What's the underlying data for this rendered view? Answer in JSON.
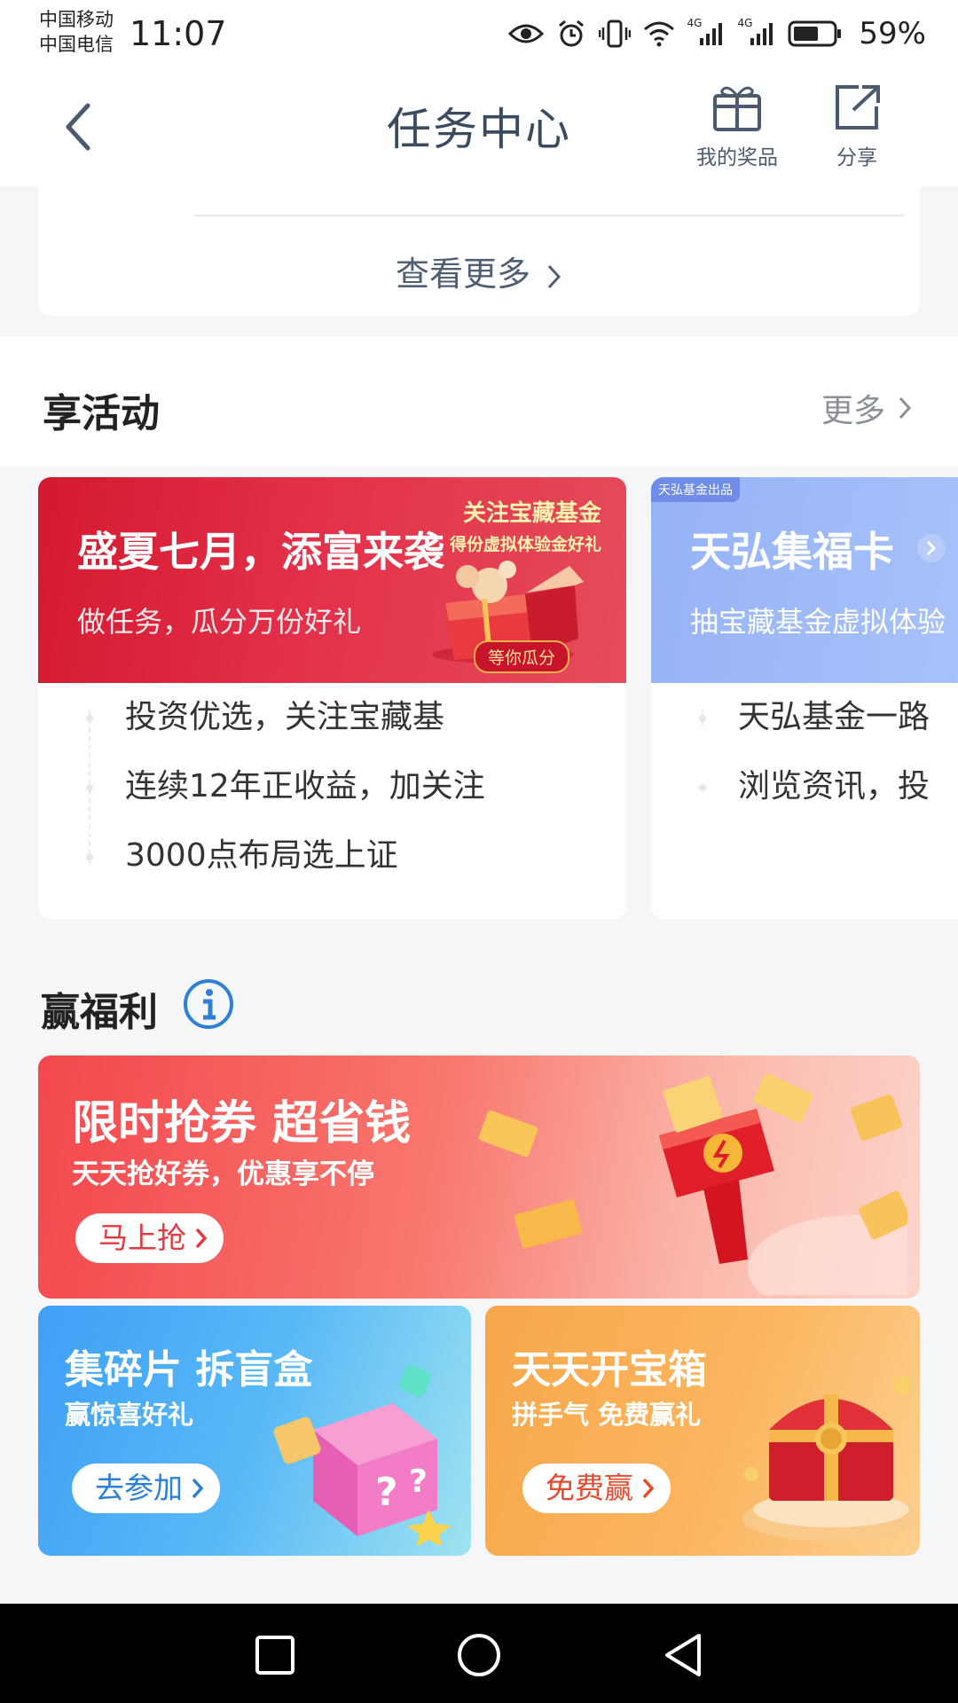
{
  "status_bar": {
    "carrier_1": "中国移动",
    "carrier_2": "中国电信",
    "time": "11:07",
    "net_1": "4G",
    "net_2": "4G",
    "battery": "59%"
  },
  "header": {
    "title": "任务中心",
    "prizes_label": "我的奖品",
    "share_label": "分享"
  },
  "prev_section": {
    "see_more": "查看更多"
  },
  "activities": {
    "title": "享活动",
    "more": "更多",
    "cards": [
      {
        "banner_title": "盛夏七月，添富来袭",
        "banner_sub": "做任务，瓜分万份好礼",
        "side_line_1": "关注宝藏基金",
        "side_line_2": "得份虚拟体验金好礼",
        "badge": "等你瓜分",
        "items": [
          "投资优选，关注宝藏基",
          "连续12年正收益，加关注",
          "3000点布局选上证"
        ]
      },
      {
        "tag": "天弘基金出品",
        "banner_title": "天弘集福卡",
        "banner_sub": "抽宝藏基金虚拟体验",
        "items": [
          "天弘基金一路",
          "浏览资讯，投"
        ]
      }
    ]
  },
  "welfare": {
    "title": "赢福利",
    "promos": [
      {
        "title": "限时抢券 超省钱",
        "sub": "天天抢好券，优惠享不停",
        "button": "马上抢"
      },
      {
        "title": "集碎片 拆盲盒",
        "sub": "赢惊喜好礼",
        "button": "去参加"
      },
      {
        "title": "天天开宝箱",
        "sub": "拼手气 免费赢礼",
        "button": "免费赢"
      }
    ]
  },
  "colors": {
    "red_banner": "#d3192f",
    "blue_banner": "#96b3f7",
    "promo_red": "#f3474e",
    "promo_blue": "#3fa0f7",
    "promo_orange": "#f8a74a",
    "header_text": "#3b4b5f"
  }
}
